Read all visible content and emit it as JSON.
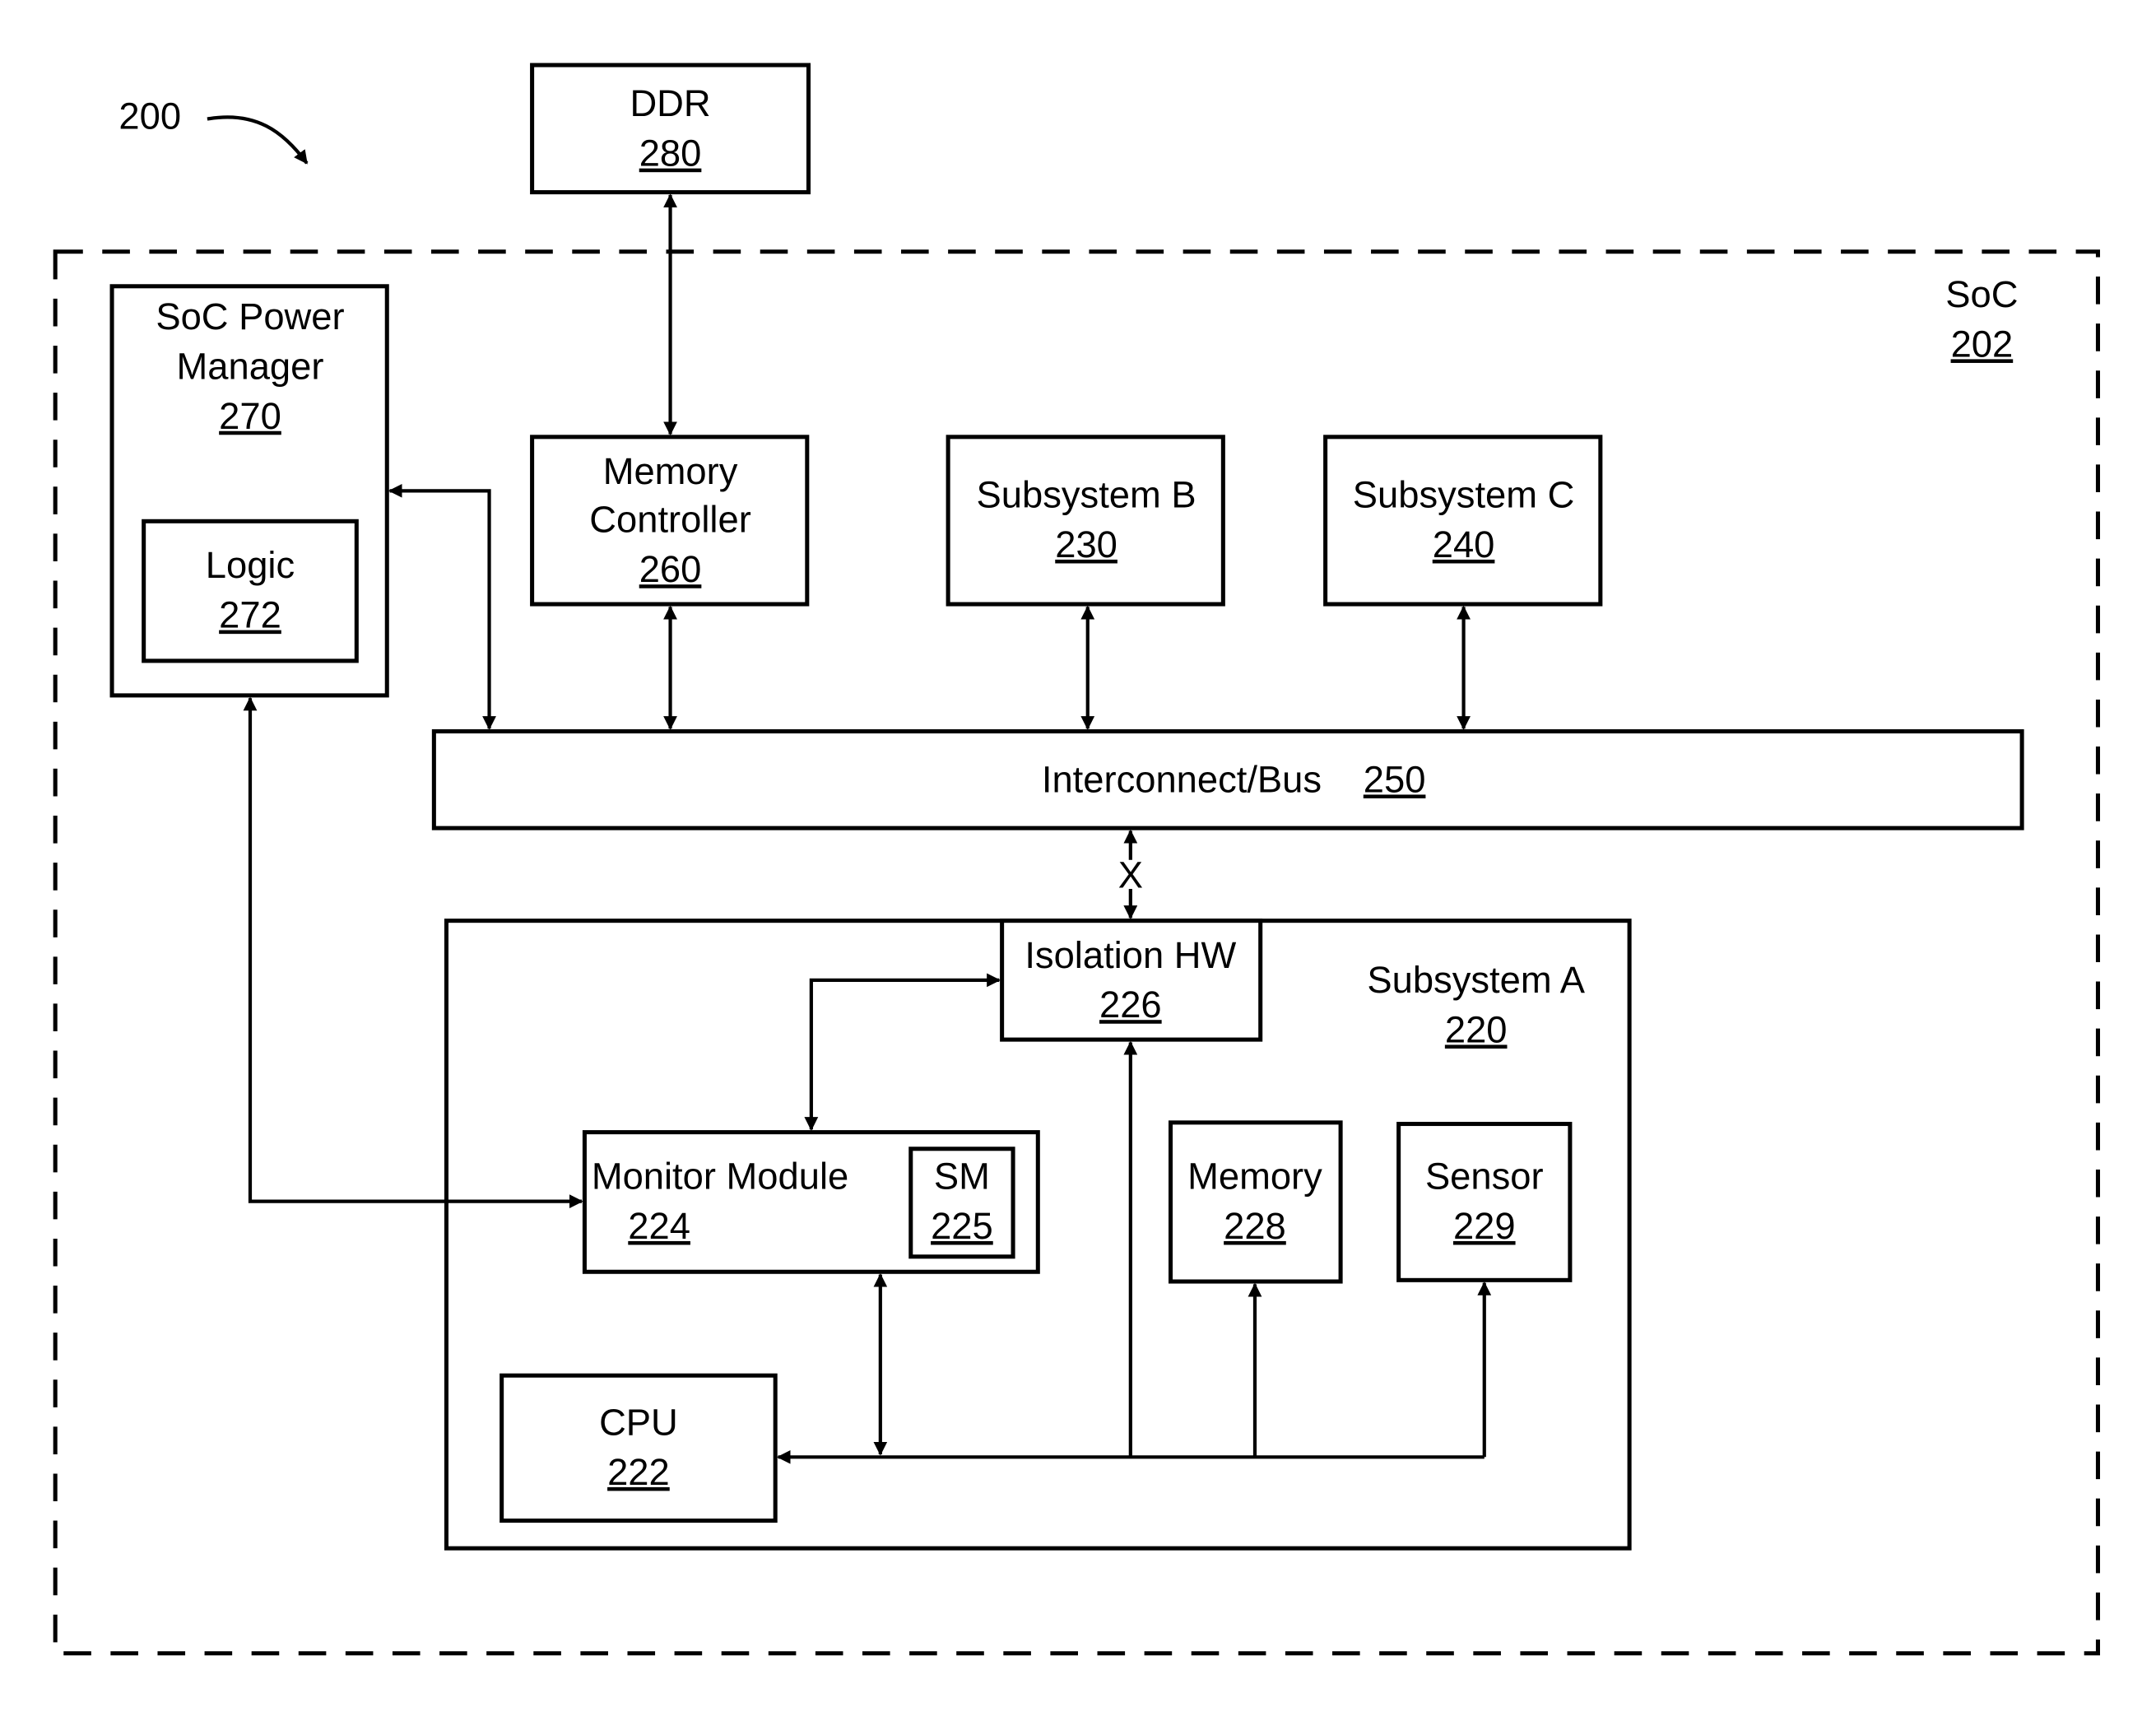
{
  "figure": {
    "ref": "200",
    "soc": {
      "label": "SoC",
      "num": "202"
    },
    "ddr": {
      "label": "DDR",
      "num": "280"
    },
    "power_manager": {
      "label_line1": "SoC Power",
      "label_line2": "Manager",
      "num": "270"
    },
    "logic": {
      "label": "Logic",
      "num": "272"
    },
    "memory_controller": {
      "label_line1": "Memory",
      "label_line2": "Controller",
      "num": "260"
    },
    "subsystem_b": {
      "label": "Subsystem B",
      "num": "230"
    },
    "subsystem_c": {
      "label": "Subsystem C",
      "num": "240"
    },
    "bus": {
      "label": "Interconnect/Bus",
      "num": "250"
    },
    "isolation_hw": {
      "label": "Isolation HW",
      "num": "226"
    },
    "subsystem_a": {
      "label": "Subsystem A",
      "num": "220"
    },
    "monitor_module": {
      "label": "Monitor Module",
      "num": "224"
    },
    "sm": {
      "label": "SM",
      "num": "225"
    },
    "memory": {
      "label": "Memory",
      "num": "228"
    },
    "sensor": {
      "label": "Sensor",
      "num": "229"
    },
    "cpu": {
      "label": "CPU",
      "num": "222"
    },
    "isolation_marker": "X"
  }
}
